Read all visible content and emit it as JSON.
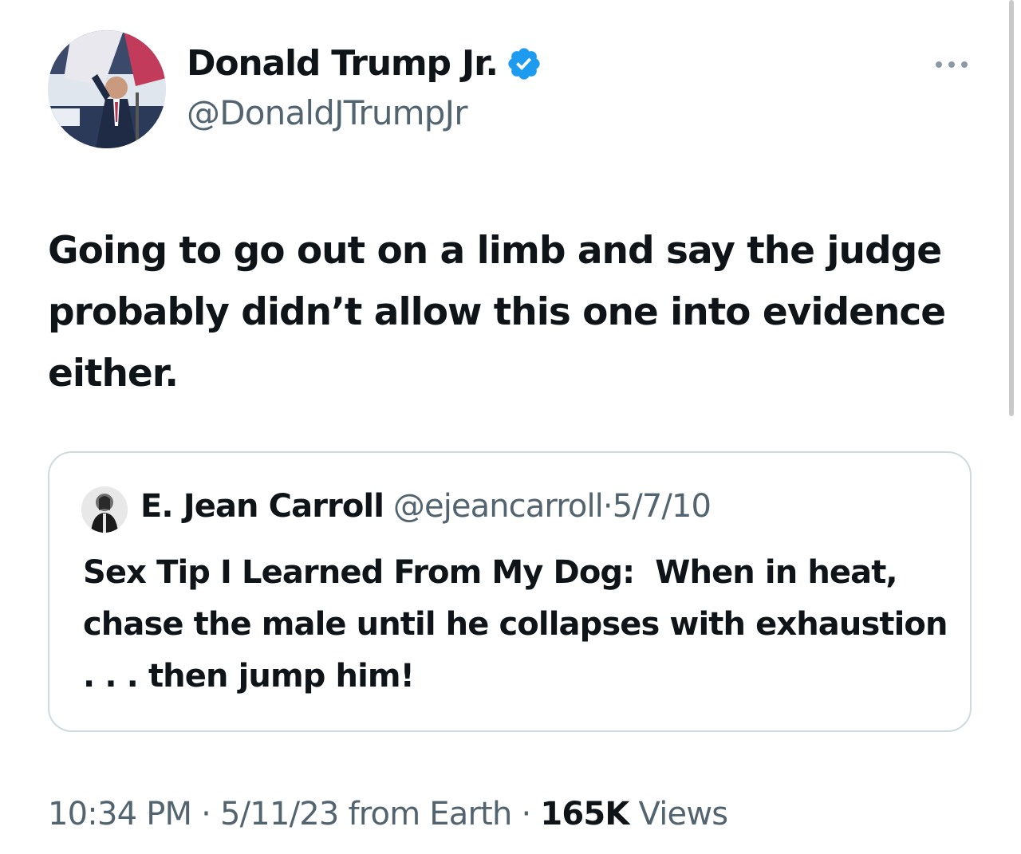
{
  "author": {
    "display_name": "Donald Trump Jr.",
    "handle": "@DonaldJTrumpJr",
    "verified": true
  },
  "icons": {
    "verified": "verified-badge-icon",
    "more": "more-options-icon"
  },
  "tweet": {
    "text": "Going to go out on a limb and say the judge probably didn’t allow this one into evidence either."
  },
  "quoted_tweet": {
    "display_name": "E. Jean Carroll",
    "handle": "@ejeancarroll",
    "separator": "·",
    "date": "5/7/10",
    "text": "Sex Tip I Learned From My Dog:  When in heat, chase the male until he collapses with exhaustion  . . . then jump him!"
  },
  "meta": {
    "time": "10:34 PM",
    "separator1": " · ",
    "date": "5/11/23 from Earth",
    "separator2": " · ",
    "views_count": "165K",
    "views_label": " Views"
  },
  "colors": {
    "text_primary": "#0f1419",
    "text_secondary": "#536471",
    "verified_blue": "#1d9bf0",
    "border": "#cfd9de"
  }
}
